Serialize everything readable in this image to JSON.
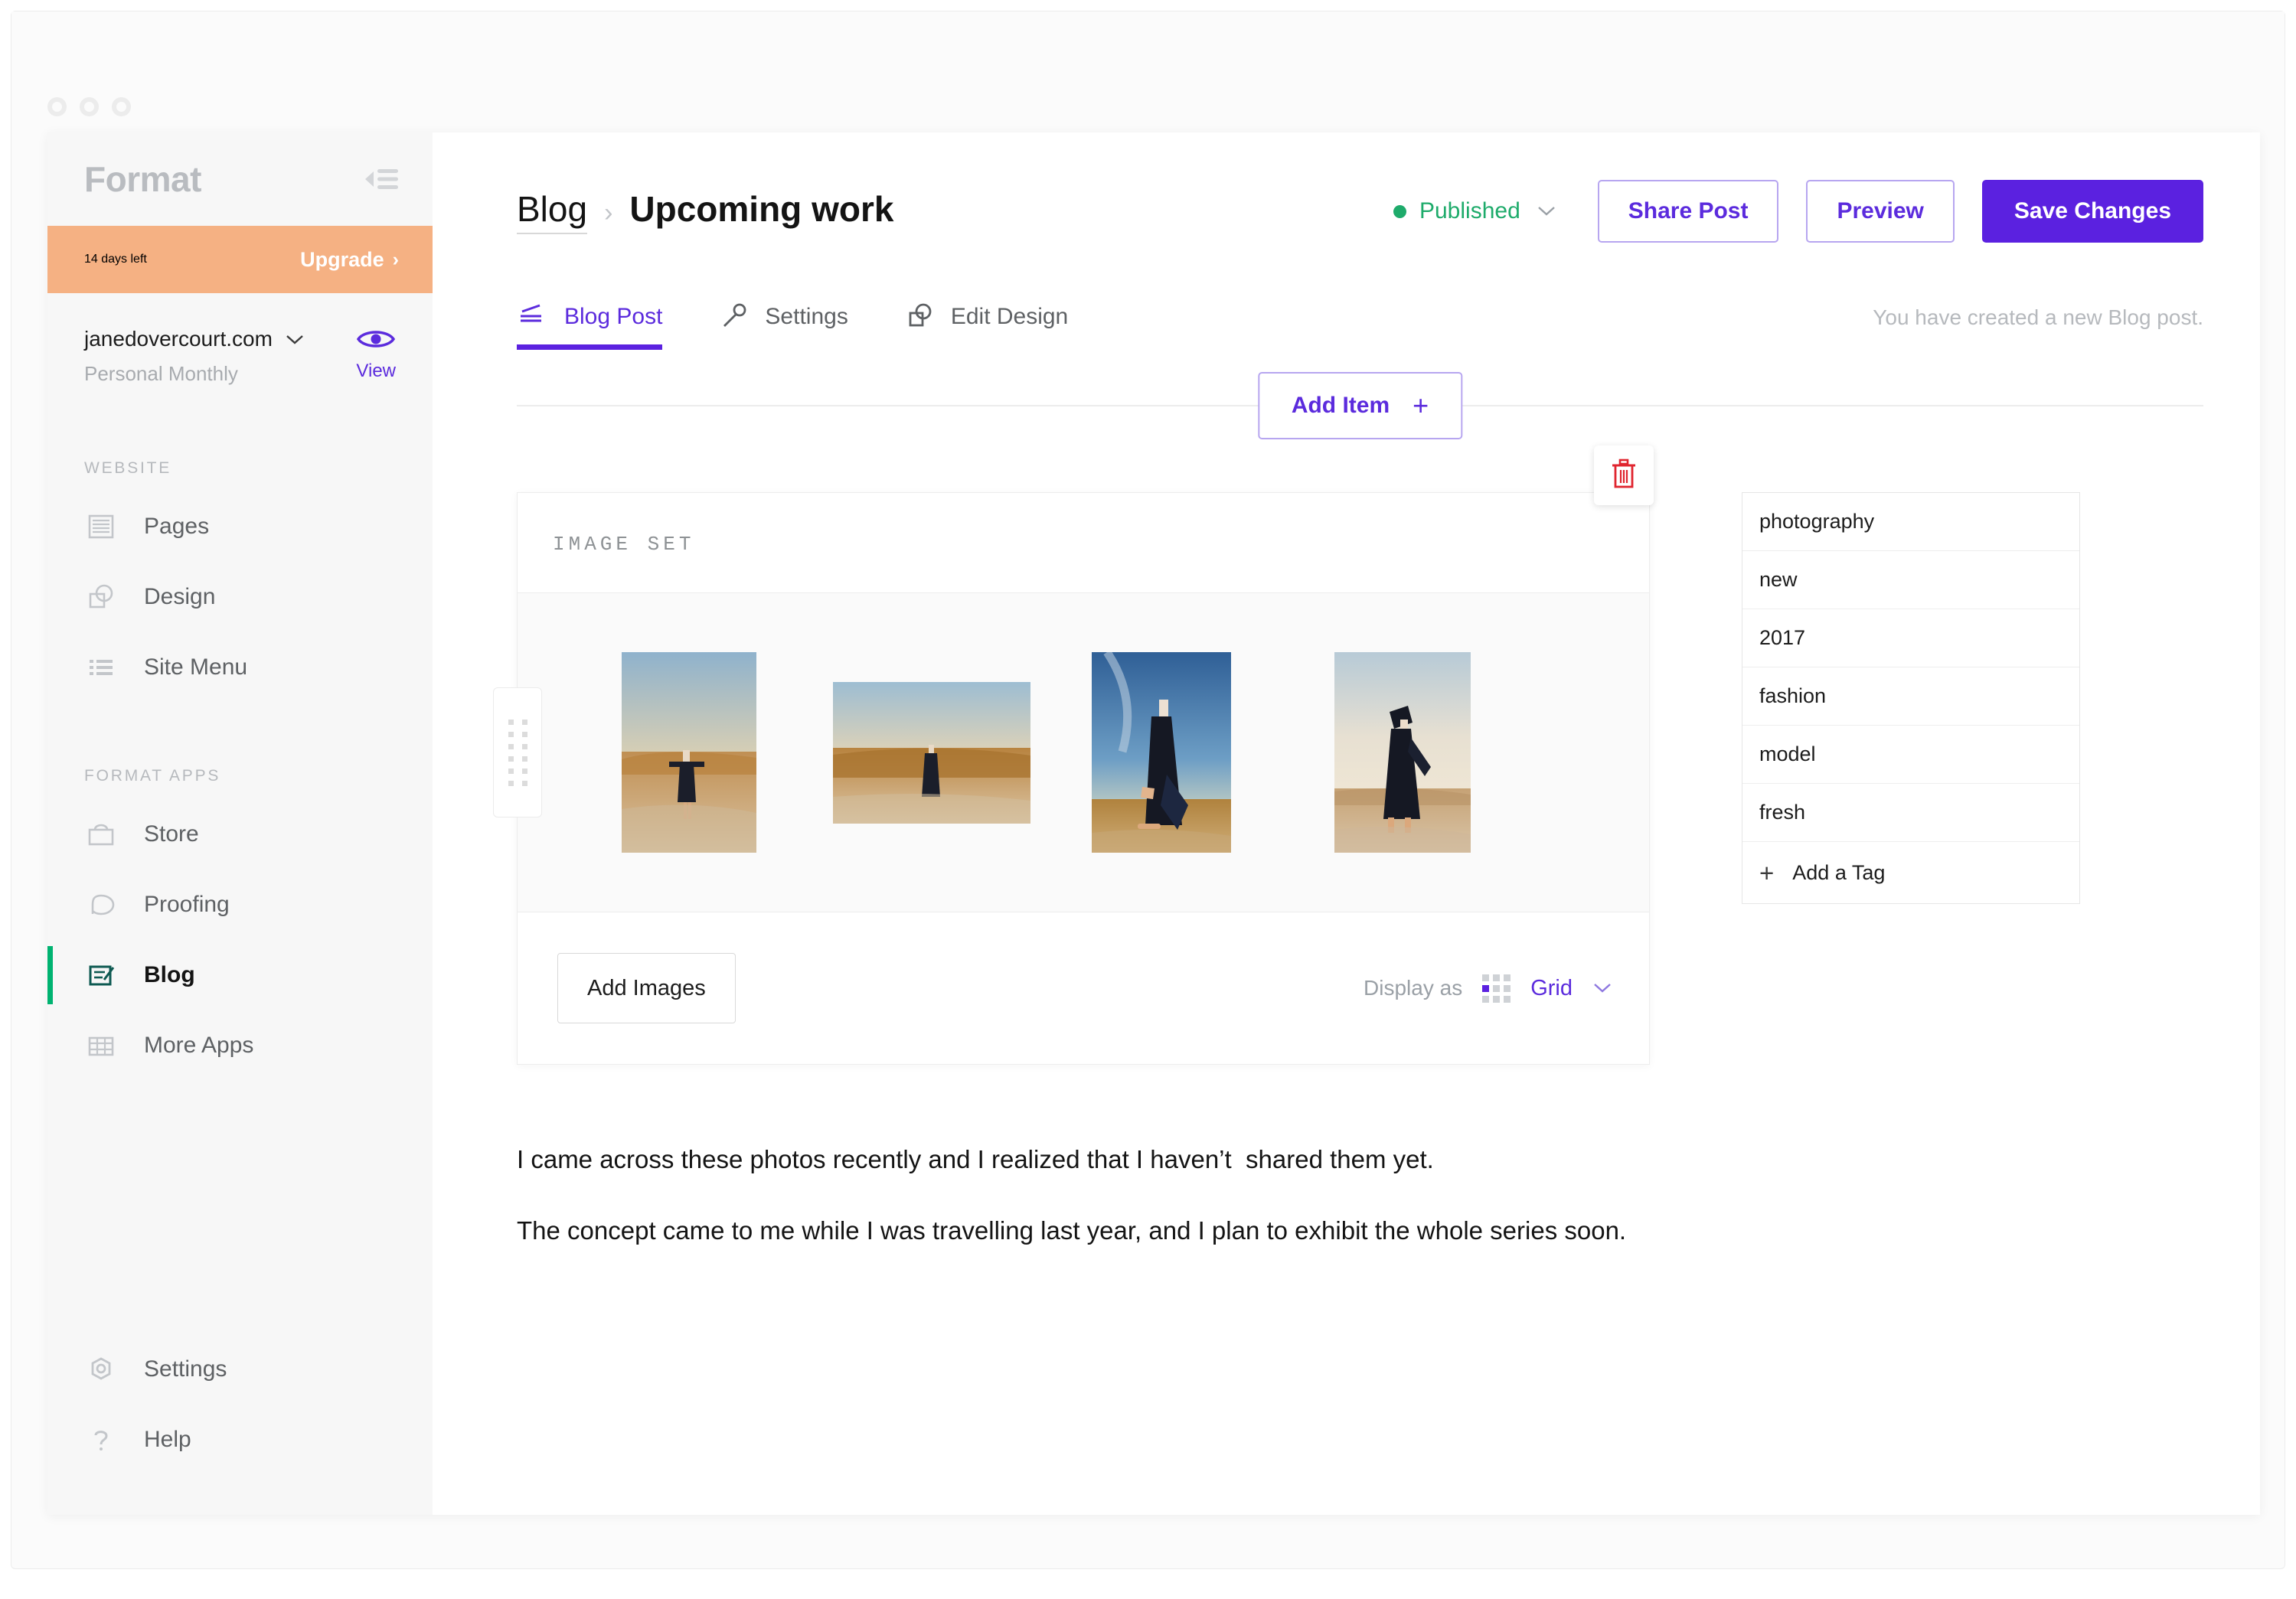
{
  "window": {
    "dots": [
      "close",
      "minimize",
      "maximize"
    ]
  },
  "sidebar": {
    "brand": "Format",
    "collapse_icon": "collapse-sidebar-icon",
    "trial": {
      "days_label": "14 days left",
      "upgrade_label": "Upgrade",
      "chevron": "›",
      "bg": "#f5b183"
    },
    "site": {
      "domain": "janedovercourt.com",
      "plan": "Personal Monthly",
      "view_label": "View",
      "chevron": "⌄"
    },
    "sections": [
      {
        "title": "WEBSITE",
        "items": [
          {
            "label": "Pages",
            "icon": "pages-icon",
            "active": false
          },
          {
            "label": "Design",
            "icon": "design-icon",
            "active": false
          },
          {
            "label": "Site Menu",
            "icon": "site-menu-icon",
            "active": false
          }
        ]
      },
      {
        "title": "FORMAT APPS",
        "items": [
          {
            "label": "Store",
            "icon": "store-icon",
            "active": false
          },
          {
            "label": "Proofing",
            "icon": "proofing-icon",
            "active": false
          },
          {
            "label": "Blog",
            "icon": "blog-icon",
            "active": true
          },
          {
            "label": "More Apps",
            "icon": "more-apps-icon",
            "active": false
          }
        ]
      }
    ],
    "bottom_items": [
      {
        "label": "Settings",
        "icon": "gear-icon"
      },
      {
        "label": "Help",
        "icon": "question-mark-icon"
      }
    ],
    "accent_active": "#00b371"
  },
  "header": {
    "breadcrumb_root": "Blog",
    "breadcrumb_sep": "›",
    "breadcrumb_current": "Upcoming work",
    "status": {
      "label": "Published",
      "color": "#1eab6b",
      "chevron": "⌄"
    },
    "buttons": {
      "share": "Share Post",
      "preview": "Preview",
      "save": "Save Changes"
    },
    "accent": "#5b21e0"
  },
  "tabs": [
    {
      "label": "Blog Post",
      "icon": "edit-lines-icon",
      "active": true
    },
    {
      "label": "Settings",
      "icon": "wrench-icon",
      "active": false
    },
    {
      "label": "Edit Design",
      "icon": "design-icon",
      "active": false
    }
  ],
  "notice": "You have created a new Blog post.",
  "add_item": {
    "label": "Add Item",
    "plus": "+"
  },
  "image_set_card": {
    "kicker": "IMAGE SET",
    "delete_icon": "trash-icon",
    "drag_handle_icon": "drag-handle-icon",
    "thumbnails": [
      {
        "alt": "figure standing arms out on dune"
      },
      {
        "alt": "figure walking on sand wide shot"
      },
      {
        "alt": "figure kneeling against blue sky"
      },
      {
        "alt": "figure arms raised on beach"
      }
    ],
    "add_images_label": "Add Images",
    "display_as_label": "Display as",
    "display_value": "Grid",
    "display_chevron": "⌄",
    "display_icon": "grid-icon"
  },
  "tags": {
    "items": [
      "photography",
      "new",
      "2017",
      "fashion",
      "model",
      "fresh"
    ],
    "add_label": "Add a Tag",
    "add_plus": "+"
  },
  "post_body": {
    "paragraphs": [
      "I came across these photos recently and I realized that I haven’t  shared them yet.",
      "The concept came to me while I was travelling last year, and I plan to exhibit the whole series soon."
    ]
  }
}
